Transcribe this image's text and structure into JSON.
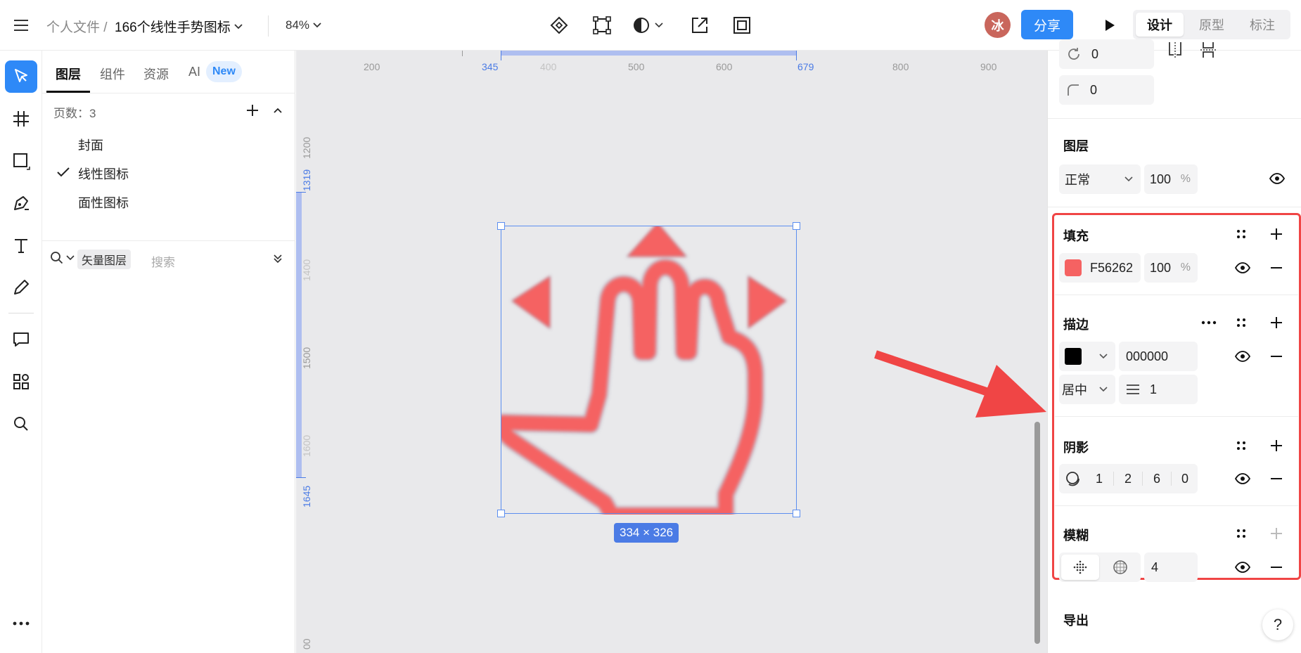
{
  "topbar": {
    "breadcrumb_parent": "个人文件",
    "breadcrumb_sep": "/",
    "file_name": "166个线性手势图标",
    "zoom": "84%",
    "avatar": "冰",
    "share": "分享",
    "modes": [
      "设计",
      "原型",
      "标注"
    ]
  },
  "panel": {
    "tabs": [
      "图层",
      "组件",
      "资源",
      "AI"
    ],
    "ai_badge": "New",
    "pages_label": "页数：3",
    "pages": [
      "封面",
      "线性图标",
      "面性图标"
    ],
    "filter_chip": "矢量图层",
    "search_placeholder": "搜索"
  },
  "canvas": {
    "ruler_x": [
      "200",
      "345",
      "400",
      "500",
      "600",
      "679",
      "800",
      "900"
    ],
    "ruler_y": [
      "1200",
      "1319",
      "1400",
      "1500",
      "1600",
      "1645",
      "00"
    ],
    "size_label": "334 × 326",
    "icon_color": "#F56262",
    "selection_color": "#5b8ef0"
  },
  "props": {
    "rotation": "0",
    "radius": "0",
    "layer": {
      "title": "图层",
      "blend": "正常",
      "opacity": "100",
      "unit": "%"
    },
    "fill": {
      "title": "填充",
      "hex": "F56262",
      "color": "#F56262",
      "opacity": "100",
      "unit": "%"
    },
    "stroke": {
      "title": "描边",
      "hex": "000000",
      "color": "#000000",
      "align": "居中",
      "width": "1"
    },
    "shadow": {
      "title": "阴影",
      "x": "1",
      "y": "2",
      "blur": "6",
      "spread": "0"
    },
    "blur": {
      "title": "模糊",
      "value": "4"
    },
    "export": {
      "title": "导出"
    },
    "help": "?"
  },
  "annotation_color": "#f04545"
}
